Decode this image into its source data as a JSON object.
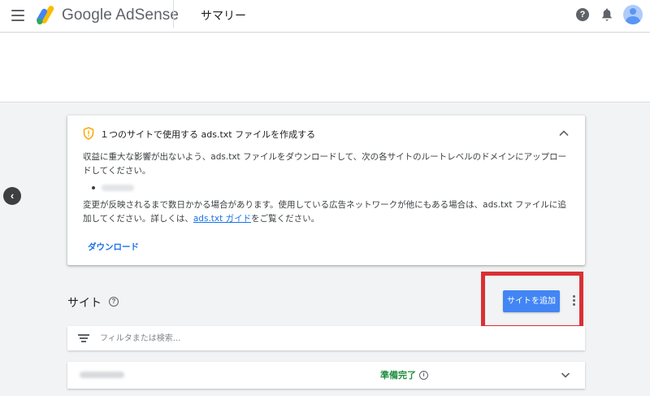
{
  "header": {
    "app_name": "Google AdSense",
    "page_title": "サマリー",
    "help_glyph": "?"
  },
  "notice": {
    "title": "１つのサイトで使用する ads.txt ファイルを作成する",
    "paragraph1": "収益に重大な影響が出ないよう、ads.txt ファイルをダウンロードして、次の各サイトのルートレベルのドメインにアップロードしてください。",
    "paragraph2_before_link": "変更が反映されるまで数日かかる場合があります。使用している広告ネットワークが他にもある場合は、ads.txt ファイルに追加してください。詳しくは、",
    "link_text": "ads.txt ガイド",
    "paragraph2_after_link": "をご覧ください。",
    "download_label": "ダウンロード"
  },
  "sites": {
    "heading": "サイト",
    "help_glyph": "?",
    "add_button_label": "サイトを追加",
    "filter_placeholder": "フィルタまたは検索...",
    "rows": [
      {
        "status": "準備完了",
        "info_glyph": "i"
      }
    ]
  },
  "nav": {
    "back_glyph": "‹"
  },
  "colors": {
    "accent_blue": "#4285f4",
    "link_blue": "#1a73e8",
    "status_green": "#1e8e3e",
    "highlight_red": "#d93035",
    "warning_amber": "#f9ab00"
  },
  "icons": [
    "menu-icon",
    "adsense-logo",
    "help-icon",
    "bell-icon",
    "avatar",
    "warning-shield-icon",
    "chevron-up-icon",
    "chevron-left-icon",
    "more-vert-icon",
    "filter-icon",
    "info-icon",
    "chevron-down-icon"
  ]
}
